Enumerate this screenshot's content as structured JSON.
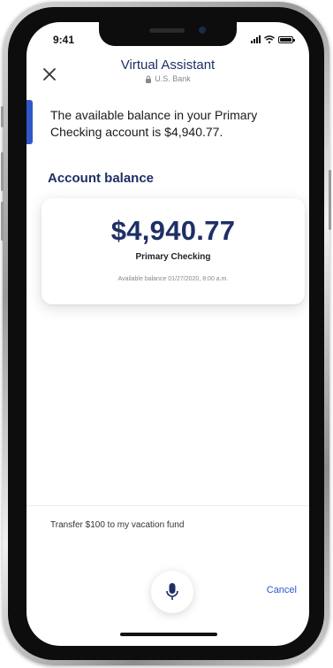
{
  "status_bar": {
    "time": "9:41"
  },
  "header": {
    "title": "Virtual Assistant",
    "subtitle": "U.S. Bank",
    "close_icon": "close-icon",
    "lock_icon": "lock-icon"
  },
  "conversation": {
    "assistant_message": "The available balance in your Primary Checking account is $4,940.77."
  },
  "account_section": {
    "title": "Account balance",
    "card": {
      "amount": "$4,940.77",
      "account_name": "Primary Checking",
      "date_text": "Available balance 01/27/2020, 8:00 a.m."
    }
  },
  "input": {
    "transcribed_text": "Transfer $100 to my vacation fund",
    "mic_icon": "microphone-icon",
    "cancel_label": "Cancel"
  },
  "colors": {
    "brand_navy": "#1e2f66",
    "accent_blue": "#2f57c9"
  }
}
